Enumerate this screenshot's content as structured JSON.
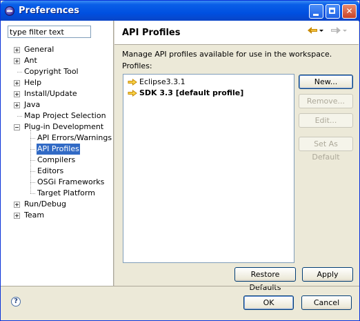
{
  "window": {
    "title": "Preferences"
  },
  "title_buttons": {
    "minimize": "",
    "maximize": "",
    "close": "✕"
  },
  "filter": {
    "value": "type filter text"
  },
  "tree": [
    {
      "label": "General",
      "expandable": true
    },
    {
      "label": "Ant",
      "expandable": true
    },
    {
      "label": "Copyright Tool",
      "expandable": false
    },
    {
      "label": "Help",
      "expandable": true
    },
    {
      "label": "Install/Update",
      "expandable": true
    },
    {
      "label": "Java",
      "expandable": true
    },
    {
      "label": "Map Project Selection",
      "expandable": false
    },
    {
      "label": "Plug-in Development",
      "expandable": true,
      "expanded": true,
      "children": [
        "API Errors/Warnings",
        "API Profiles",
        "Compilers",
        "Editors",
        "OSGi Frameworks",
        "Target Platform"
      ],
      "selected_child": "API Profiles"
    },
    {
      "label": "Run/Debug",
      "expandable": true
    },
    {
      "label": "Team",
      "expandable": true
    }
  ],
  "page": {
    "title": "API Profiles",
    "description": "Manage API profiles available for use in the workspace.",
    "list_label": "Profiles:",
    "profiles": [
      {
        "name": "Eclipse3.3.1",
        "default": false
      },
      {
        "name": "SDK 3.3  [default profile]",
        "default": true
      }
    ],
    "buttons": {
      "new": "New...",
      "remove": "Remove...",
      "edit": "Edit...",
      "set_default": "Set As Default"
    },
    "restore_defaults": "Restore Defaults",
    "apply": "Apply"
  },
  "footer": {
    "help": "?",
    "ok": "OK",
    "cancel": "Cancel"
  },
  "icons": {
    "back": "back-arrow-icon",
    "forward": "forward-arrow-icon",
    "profile": "profile-arrow-icon",
    "help": "help-icon"
  },
  "colors": {
    "accent": "#316ac5",
    "titlebar": "#0a5fe8",
    "profile_arrow": "#e8a800"
  }
}
